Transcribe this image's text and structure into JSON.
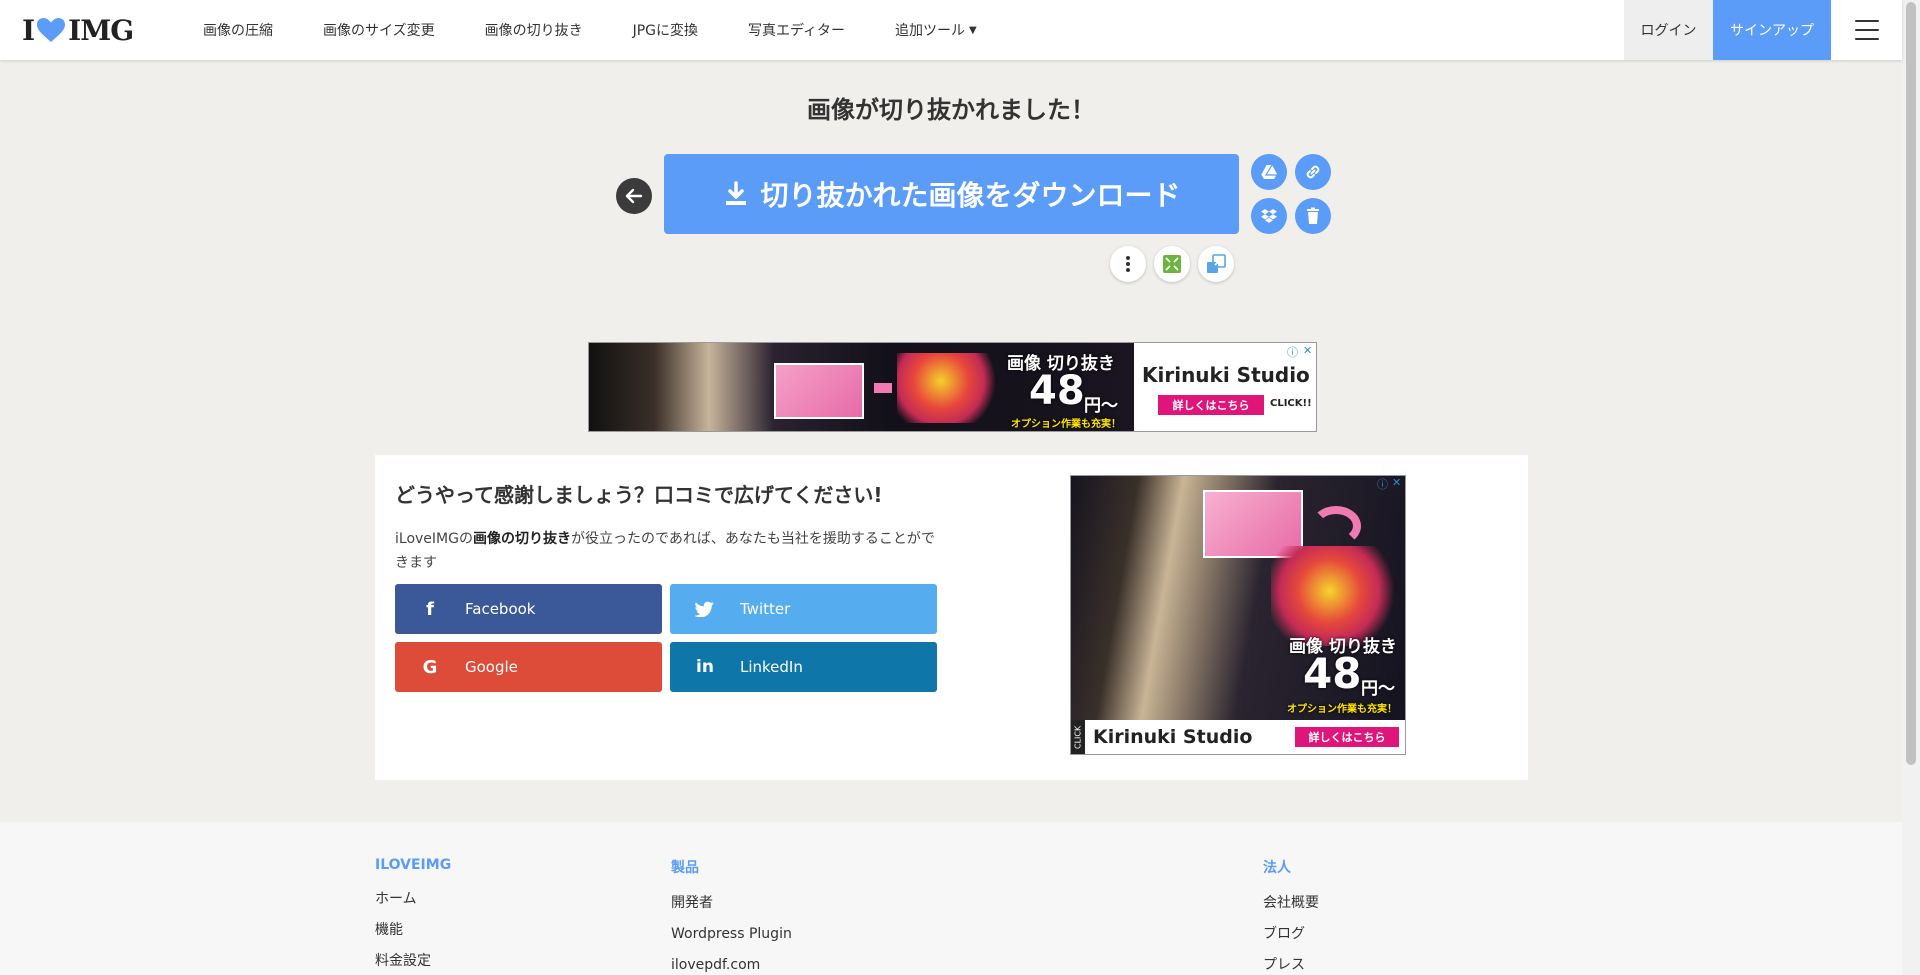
{
  "header": {
    "logo_left": "I",
    "logo_right": "IMG",
    "nav": [
      {
        "label": "画像の圧縮"
      },
      {
        "label": "画像のサイズ変更"
      },
      {
        "label": "画像の切り抜き"
      },
      {
        "label": "JPGに変換"
      },
      {
        "label": "写真エディター"
      },
      {
        "label": "追加ツール"
      }
    ],
    "login_label": "ログイン",
    "signup_label": "サインアップ"
  },
  "main": {
    "title": "画像が切り抜かれました！",
    "download_label": "切り抜かれた画像をダウンロード",
    "side_icons": [
      "google-drive-icon",
      "link-icon",
      "dropbox-icon",
      "trash-icon"
    ],
    "extra_icons": [
      "more-vert-icon",
      "compress-icon",
      "resize-icon"
    ]
  },
  "ad_banner": {
    "headline": "画像 切り抜き",
    "price": "48",
    "price_unit": "円〜",
    "note": "オプション作業も充実！",
    "brand": "Kirinuki Studio",
    "cta": "詳しくはこちら",
    "click": "CLICK!!"
  },
  "share": {
    "title": "どうやって感謝しましょう？口コミで広げてください!",
    "desc_prefix": "iLoveIMGの",
    "desc_bold": "画像の切り抜き",
    "desc_suffix": "が役立ったのであれば、あなたも当社を援助することができます",
    "buttons": [
      {
        "label": "Facebook",
        "color": "#3b5998"
      },
      {
        "label": "Twitter",
        "color": "#55acee"
      },
      {
        "label": "Google",
        "color": "#dd4b39"
      },
      {
        "label": "LinkedIn",
        "color": "#0e76a8"
      }
    ]
  },
  "ad_square": {
    "headline": "画像 切り抜き",
    "price": "48",
    "price_unit": "円〜",
    "note": "オプション作業も充実！",
    "brand": "Kirinuki Studio",
    "cta": "詳しくはこちら",
    "click": "CLICK"
  },
  "footer": {
    "columns": [
      {
        "heading": "ILOVEIMG",
        "links": [
          "ホーム",
          "機能",
          "料金設定"
        ]
      },
      {
        "heading": "製品",
        "links": [
          "開発者",
          "Wordpress Plugin",
          "ilovepdf.com"
        ]
      },
      {
        "heading": "法人",
        "links": [
          "会社概要",
          "ブログ",
          "プレス"
        ]
      }
    ]
  },
  "colors": {
    "brand_blue": "#5a9cf8",
    "background": "#f1efec"
  }
}
